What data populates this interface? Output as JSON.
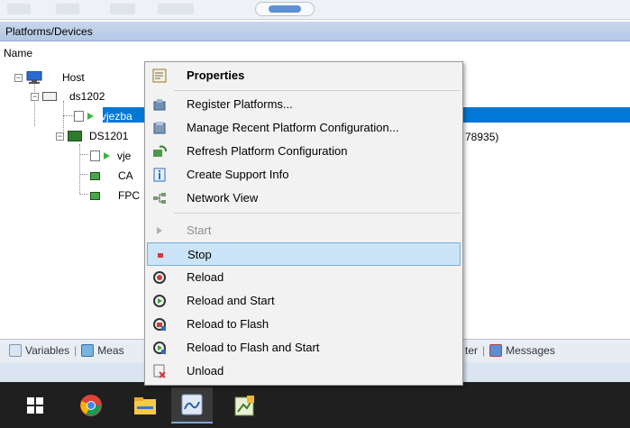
{
  "window": {
    "panel_title": "Platforms/Devices",
    "column_header": "Name"
  },
  "tree": {
    "host": "Host",
    "ds1202": "ds1202",
    "vjezba_selected": "vjezba",
    "ds1201": "DS1201",
    "vje_child": "vje",
    "ca_child": "CA",
    "fpc_child": "FPC",
    "selected_row_suffix": "78935)"
  },
  "context_menu": {
    "properties": "Properties",
    "register": "Register Platforms...",
    "manage": "Manage Recent Platform Configuration...",
    "refresh": "Refresh Platform Configuration",
    "support": "Create Support Info",
    "network": "Network View",
    "start": "Start",
    "stop": "Stop",
    "reload": "Reload",
    "reload_start": "Reload and Start",
    "reload_flash": "Reload to Flash",
    "reload_flash_start": "Reload to Flash and Start",
    "unload": "Unload"
  },
  "bottom_tabs": {
    "variables": "Variables",
    "measurement": "Meas",
    "filter": "ter",
    "messages": "Messages"
  },
  "colors": {
    "selection": "#0078d7",
    "menu_hover": "#cce4f7",
    "header": "#b3c7e4",
    "taskbar": "#1f1f1f"
  },
  "taskbar": {
    "icons": [
      "windows-start-icon",
      "chrome-icon",
      "file-explorer-icon",
      "dspace-app-icon",
      "controldesk-icon"
    ]
  }
}
